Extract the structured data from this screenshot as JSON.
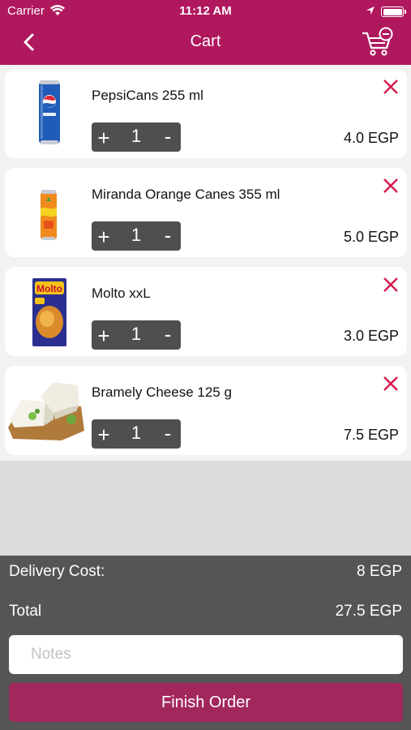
{
  "status_bar": {
    "carrier": "Carrier",
    "time": "11:12 AM"
  },
  "header": {
    "title": "Cart"
  },
  "items": [
    {
      "name": "PepsiCans 255 ml",
      "qty": "1",
      "price": "4.0 EGP",
      "plus": "+",
      "minus": "-",
      "image": "pepsi-can-image"
    },
    {
      "name": "Miranda Orange Canes 355 ml",
      "qty": "1",
      "price": "5.0 EGP",
      "plus": "+",
      "minus": "-",
      "image": "miranda-can-image"
    },
    {
      "name": "Molto xxL",
      "qty": "1",
      "price": "3.0 EGP",
      "plus": "+",
      "minus": "-",
      "image": "molto-pack-image"
    },
    {
      "name": "Bramely Cheese 125 g",
      "qty": "1",
      "price": "7.5 EGP",
      "plus": "+",
      "minus": "-",
      "image": "cheese-image"
    }
  ],
  "summary": {
    "delivery_label": "Delivery Cost:",
    "delivery_value": "8 EGP",
    "total_label": "Total",
    "total_value": "27.5 EGP"
  },
  "notes": {
    "placeholder": "Notes",
    "value": ""
  },
  "finish_button": {
    "label": "Finish Order"
  },
  "colors": {
    "header": "#b0185e",
    "remove": "#d6194d",
    "stepper": "#4f4f4f",
    "footer": "#555555",
    "button": "#a2275d"
  }
}
